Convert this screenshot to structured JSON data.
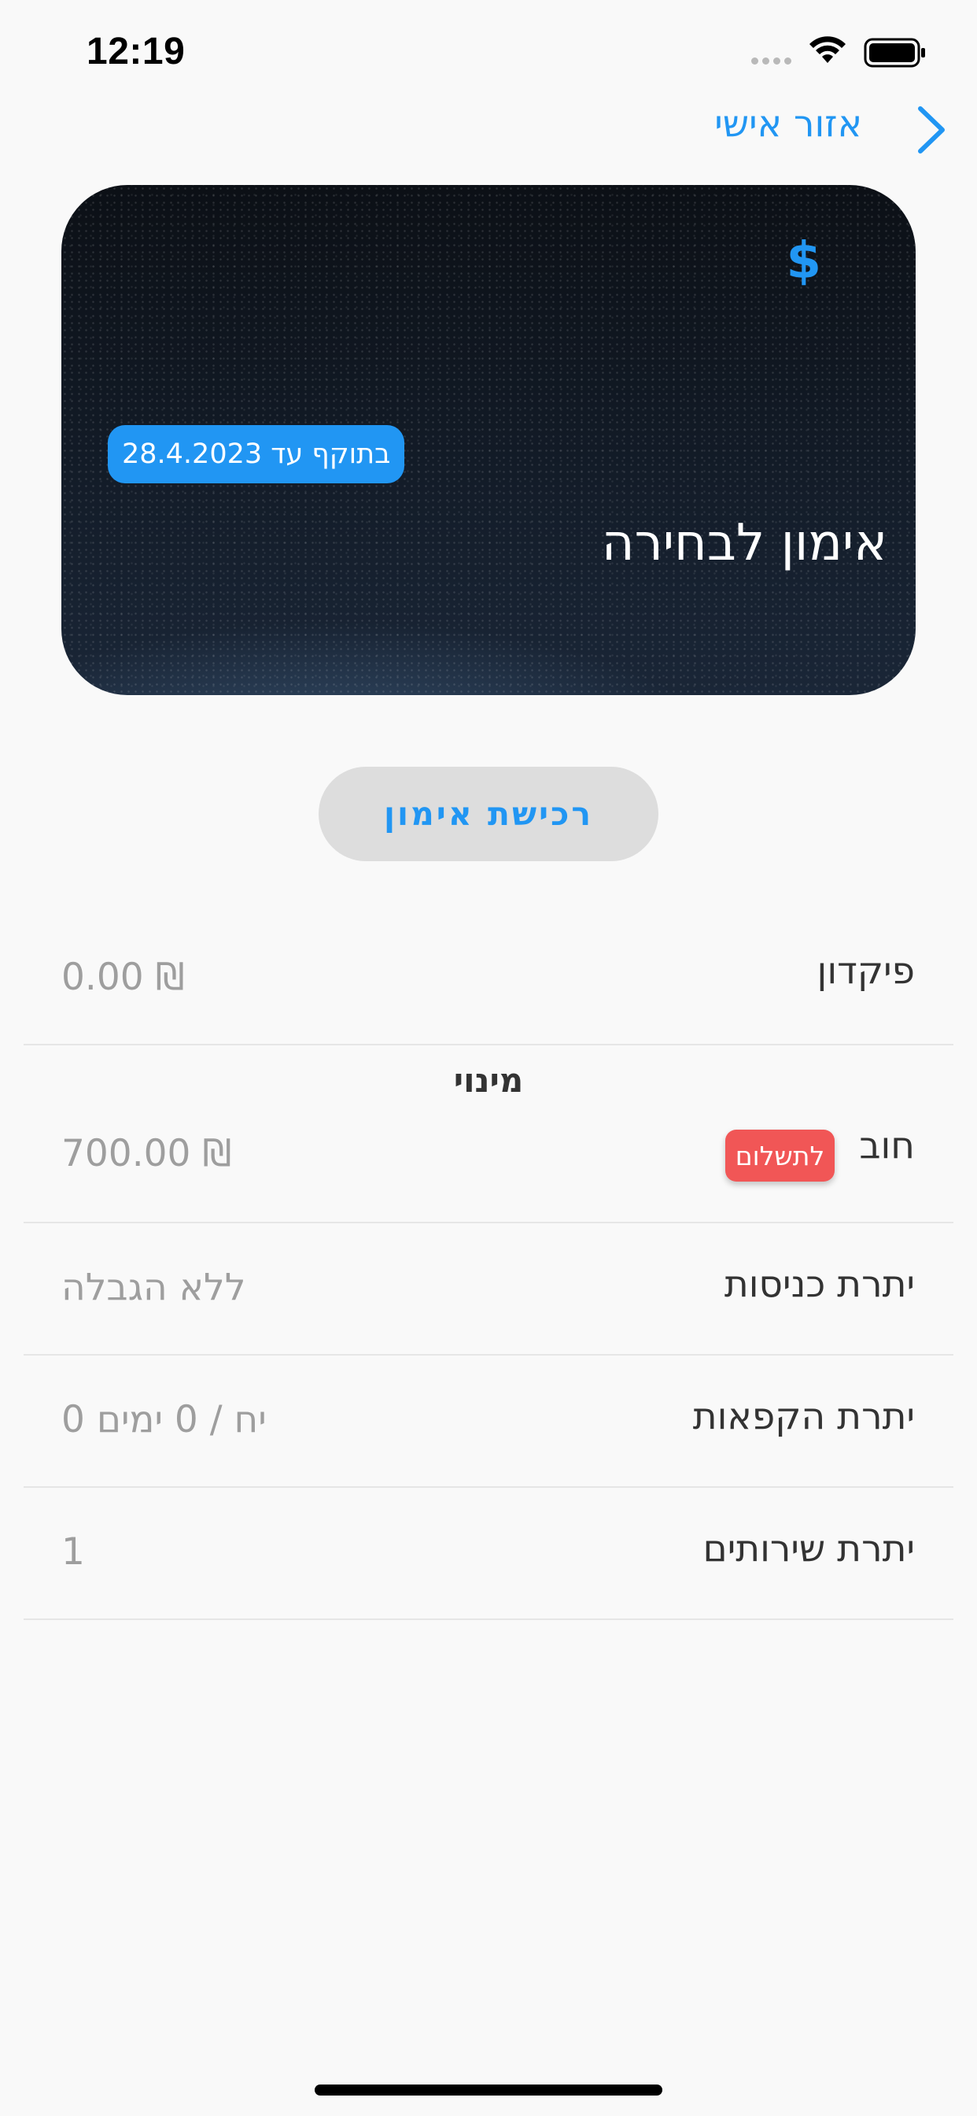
{
  "status_bar": {
    "time": "12:19"
  },
  "header": {
    "title": "אזור אישי",
    "back_icon": "chevron-right-icon"
  },
  "card": {
    "currency_symbol": "$",
    "validity": "בתוקף עד 28.4.2023",
    "title": "אימון לבחירה"
  },
  "purchase_button": {
    "label": "רכישת אימון"
  },
  "rows": {
    "deposit": {
      "label": "פיקדון",
      "value": "0.00 ₪"
    },
    "subscription_title": "מינוי",
    "debt": {
      "label": "חוב",
      "badge": "לתשלום",
      "value": "700.00 ₪"
    },
    "entries": {
      "label": "יתרת כניסות",
      "value": "ללא הגבלה"
    },
    "freezes": {
      "label": "יתרת הקפאות",
      "value": "0 יח / 0 ימים"
    },
    "services": {
      "label": "יתרת שירותים",
      "value": "1"
    }
  },
  "colors": {
    "accent": "#2196f3",
    "danger": "#f15656",
    "background": "#f9f9f9"
  }
}
